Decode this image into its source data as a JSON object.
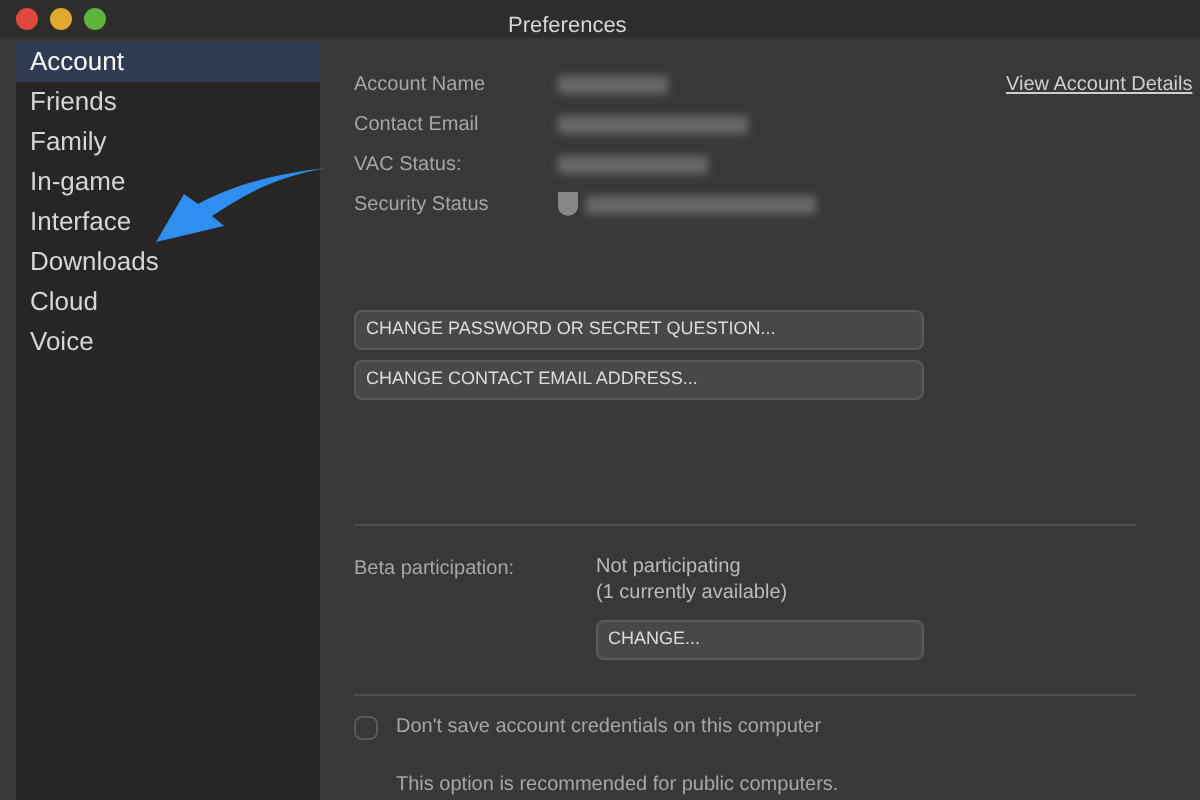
{
  "window": {
    "title": "Preferences"
  },
  "sidebar": {
    "items": [
      {
        "label": "Account",
        "selected": true
      },
      {
        "label": "Friends",
        "selected": false
      },
      {
        "label": "Family",
        "selected": false
      },
      {
        "label": "In-game",
        "selected": false
      },
      {
        "label": "Interface",
        "selected": false
      },
      {
        "label": "Downloads",
        "selected": false
      },
      {
        "label": "Cloud",
        "selected": false
      },
      {
        "label": "Voice",
        "selected": false
      }
    ]
  },
  "account": {
    "fields": [
      {
        "label": "Account Name"
      },
      {
        "label": "Contact Email"
      },
      {
        "label": "VAC Status:"
      },
      {
        "label": "Security Status",
        "icon": true
      }
    ],
    "link": "View Account Details",
    "buttons": [
      "CHANGE PASSWORD OR SECRET QUESTION...",
      "CHANGE CONTACT EMAIL ADDRESS..."
    ]
  },
  "beta": {
    "label": "Beta participation:",
    "status": "Not participating",
    "note": "(1 currently available)",
    "button": "CHANGE..."
  },
  "credentials": {
    "label": "Don't save account credentials on this computer",
    "checked": false,
    "note": "This option is recommended for public computers."
  }
}
